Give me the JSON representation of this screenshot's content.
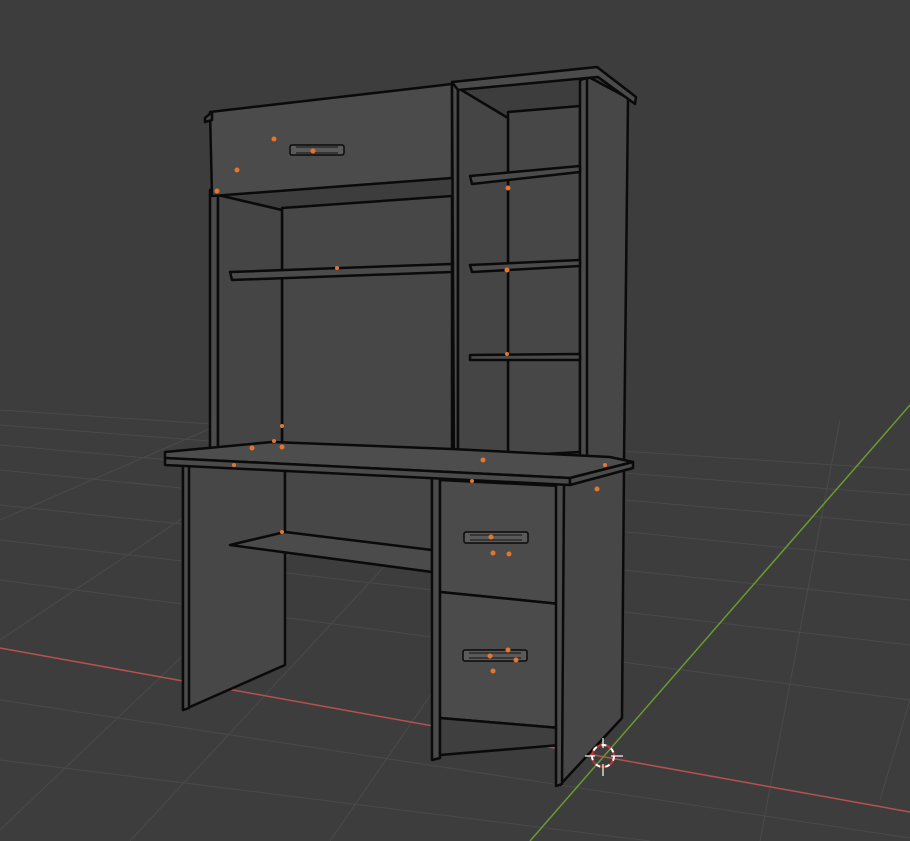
{
  "viewport": {
    "background": "#3d3d3d",
    "grid_color": "#4a4a4a",
    "x_axis_color": "#b85050",
    "y_axis_color": "#6a9a30",
    "object_fill": "#4b4b4b",
    "object_shade": "#454545",
    "outline_color": "#0a0a0a",
    "origin_color": "#e8762a",
    "cursor_colors": [
      "#ffffff",
      "#d03030"
    ]
  },
  "scene": {
    "object_type": "desk-with-hutch",
    "drawer_count": 3,
    "open_shelf_count": 4,
    "selection_mode": "object",
    "icons": [
      "3d-cursor-icon",
      "object-origin-icon",
      "drawer-handle-icon"
    ]
  }
}
